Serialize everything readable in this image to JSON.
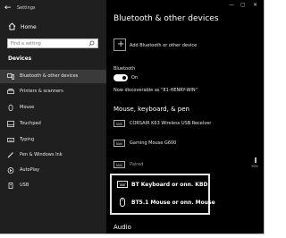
{
  "window": {
    "title": "Settings",
    "controls": [
      "—",
      "▢",
      "✕"
    ]
  },
  "sidebar": {
    "home_label": "Home",
    "search_placeholder": "Find a setting",
    "section_label": "Devices",
    "items": [
      {
        "label": "Bluetooth & other devices",
        "icon": "bluetooth-devices-icon",
        "selected": true
      },
      {
        "label": "Printers & scanners",
        "icon": "printer-icon",
        "selected": false
      },
      {
        "label": "Mouse",
        "icon": "mouse-icon",
        "selected": false
      },
      {
        "label": "Touchpad",
        "icon": "touchpad-icon",
        "selected": false
      },
      {
        "label": "Typing",
        "icon": "keyboard-icon",
        "selected": false
      },
      {
        "label": "Pen & Windows Ink",
        "icon": "pen-icon",
        "selected": false
      },
      {
        "label": "AutoPlay",
        "icon": "autoplay-icon",
        "selected": false
      },
      {
        "label": "USB",
        "icon": "usb-icon",
        "selected": false
      }
    ]
  },
  "main": {
    "title": "Bluetooth & other devices",
    "add_device_label": "Add Bluetooth or other device",
    "bluetooth": {
      "label": "Bluetooth",
      "state": "On",
      "discoverable": "Now discoverable as \"81-HENRY-WIN\""
    },
    "section_mouse_keyboard": "Mouse, keyboard, & pen",
    "devices": [
      {
        "name": "CORSAIR K63 Wireless USB Receiver",
        "icon": "keyboard-icon"
      },
      {
        "name": "Gaming Mouse G600",
        "icon": "keyboard-icon"
      },
      {
        "name": "",
        "status": "Paired",
        "battery": "90%",
        "icon": "keyboard-icon"
      }
    ],
    "highlighted": [
      {
        "name": "BT Keyboard or onn. KBD",
        "icon": "keyboard-icon"
      },
      {
        "name": "BT5.1 Mouse or onn. Mouse",
        "icon": "mouse-icon"
      }
    ],
    "section_audio": "Audio"
  },
  "colors": {
    "background": "#000000",
    "sidebar": "#1f1f1f",
    "selected": "#3a3a3a",
    "text": "#ffffff",
    "highlight_border": "#e6e6e6"
  }
}
